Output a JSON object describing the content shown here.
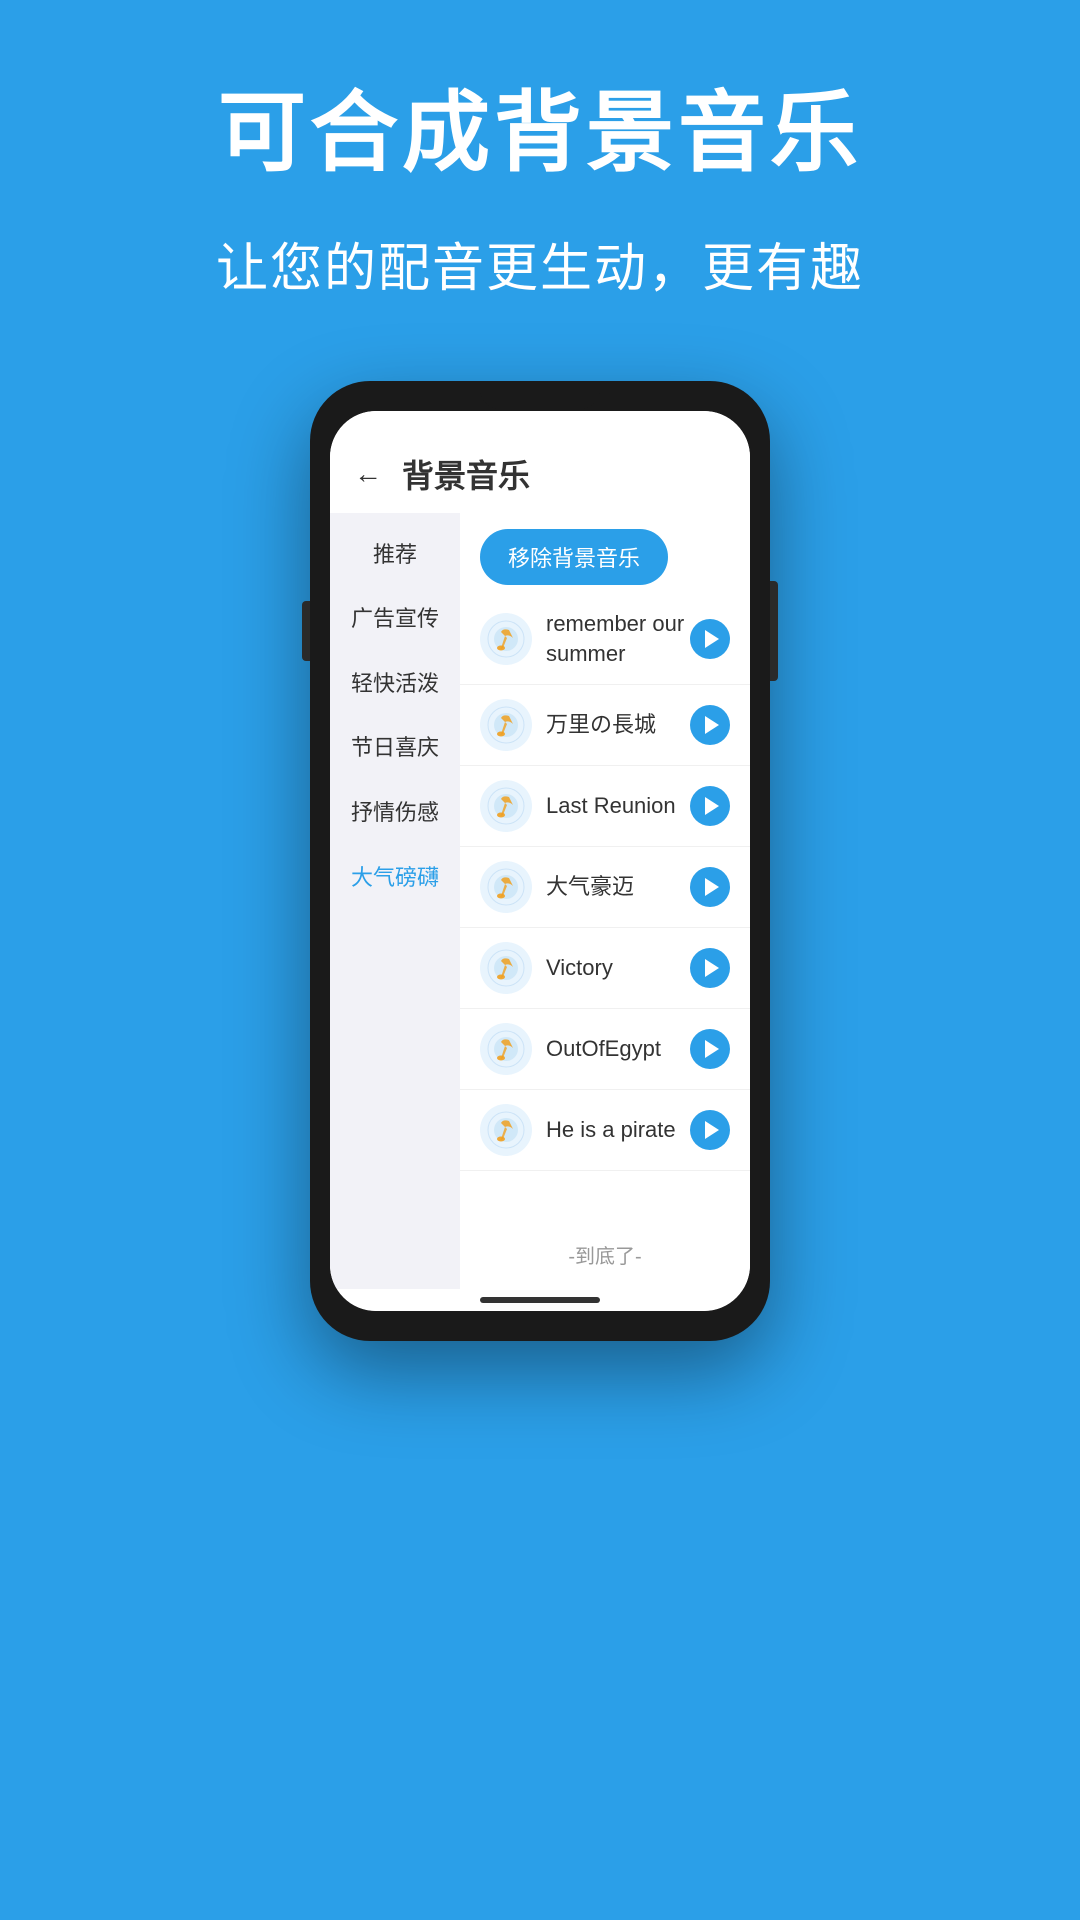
{
  "background_color": "#2B9FE8",
  "header": {
    "main_title": "可合成背景音乐",
    "sub_title": "让您的配音更生动，更有趣"
  },
  "phone": {
    "app_header": {
      "back_label": "←",
      "title": "背景音乐"
    },
    "remove_button_label": "移除背景音乐",
    "sidebar": {
      "items": [
        {
          "label": "推荐",
          "active": false
        },
        {
          "label": "广告宣传",
          "active": false
        },
        {
          "label": "轻快活泼",
          "active": false
        },
        {
          "label": "节日喜庆",
          "active": false
        },
        {
          "label": "抒情伤感",
          "active": false
        },
        {
          "label": "大气磅礴",
          "active": true
        }
      ]
    },
    "music_list": {
      "items": [
        {
          "name": "remember our summer"
        },
        {
          "name": "万里の長城"
        },
        {
          "name": "Last Reunion"
        },
        {
          "name": "大气豪迈"
        },
        {
          "name": "Victory"
        },
        {
          "name": "OutOfEgypt"
        },
        {
          "name": "He is a pirate"
        }
      ],
      "end_text": "-到底了-"
    }
  }
}
